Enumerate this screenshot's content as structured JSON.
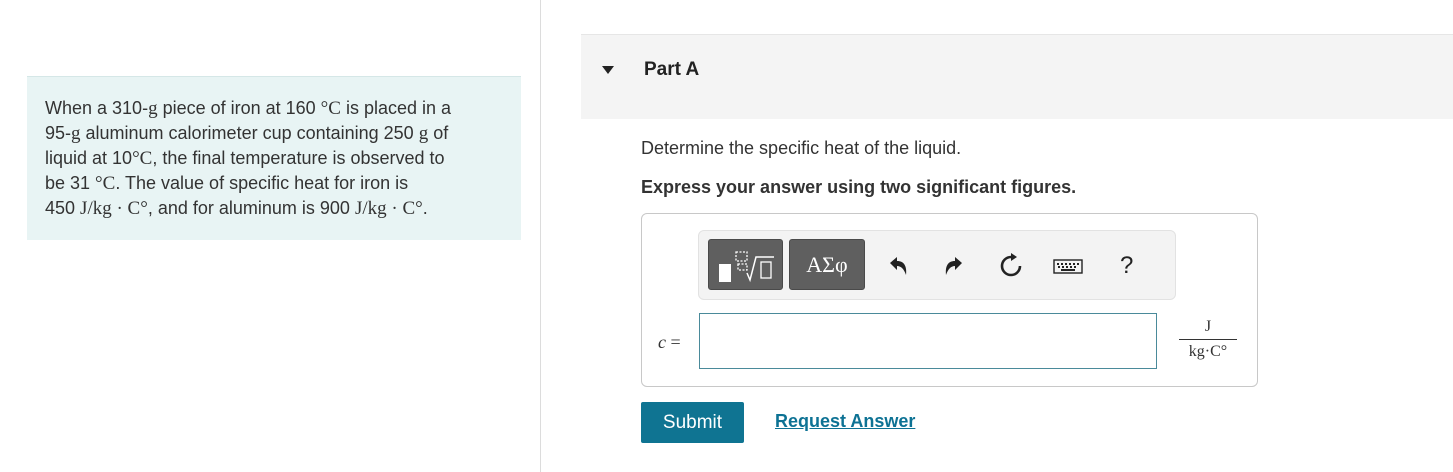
{
  "problem": {
    "line1_pre": "When a 310-",
    "line1_g": "g",
    "line1_mid": " piece of iron at 160 ",
    "line1_deg": "°C",
    "line1_post": " is placed in a",
    "line2_pre": "95-",
    "line2_g": "g",
    "line2_mid": " aluminum calorimeter cup containing 250 ",
    "line2_g2": "g",
    "line2_post": " of",
    "line3_pre": "liquid at 10",
    "line3_deg": "°C",
    "line3_post": ", the final temperature is observed to",
    "line4_pre": "be 31 ",
    "line4_deg": "°C",
    "line4_post": ". The value of specific heat for iron is",
    "line5_pre": "450 ",
    "line5_unit": "J/kg · C°",
    "line5_mid": ", and for aluminum is 900 ",
    "line5_unit2": "J/kg · C°",
    "line5_post": "."
  },
  "part": {
    "title": "Part A"
  },
  "question": {
    "text": "Determine the specific heat of the liquid.",
    "instruction": "Express your answer using two significant figures."
  },
  "answer": {
    "variable": "c",
    "equals": "=",
    "value": "",
    "unit_numerator": "J",
    "unit_denominator": "kg·C°"
  },
  "toolbar": {
    "symbols_label": "ΑΣφ",
    "help_label": "?",
    "icons": [
      "templates-icon",
      "undo-icon",
      "redo-icon",
      "reset-icon",
      "keyboard-icon",
      "help-icon"
    ]
  },
  "actions": {
    "submit_label": "Submit",
    "request_answer_label": "Request Answer"
  },
  "colors": {
    "problem_bg": "#e8f4f4",
    "part_header_bg": "#f4f4f4",
    "submit_bg": "#0f7492",
    "link": "#0d7294"
  }
}
